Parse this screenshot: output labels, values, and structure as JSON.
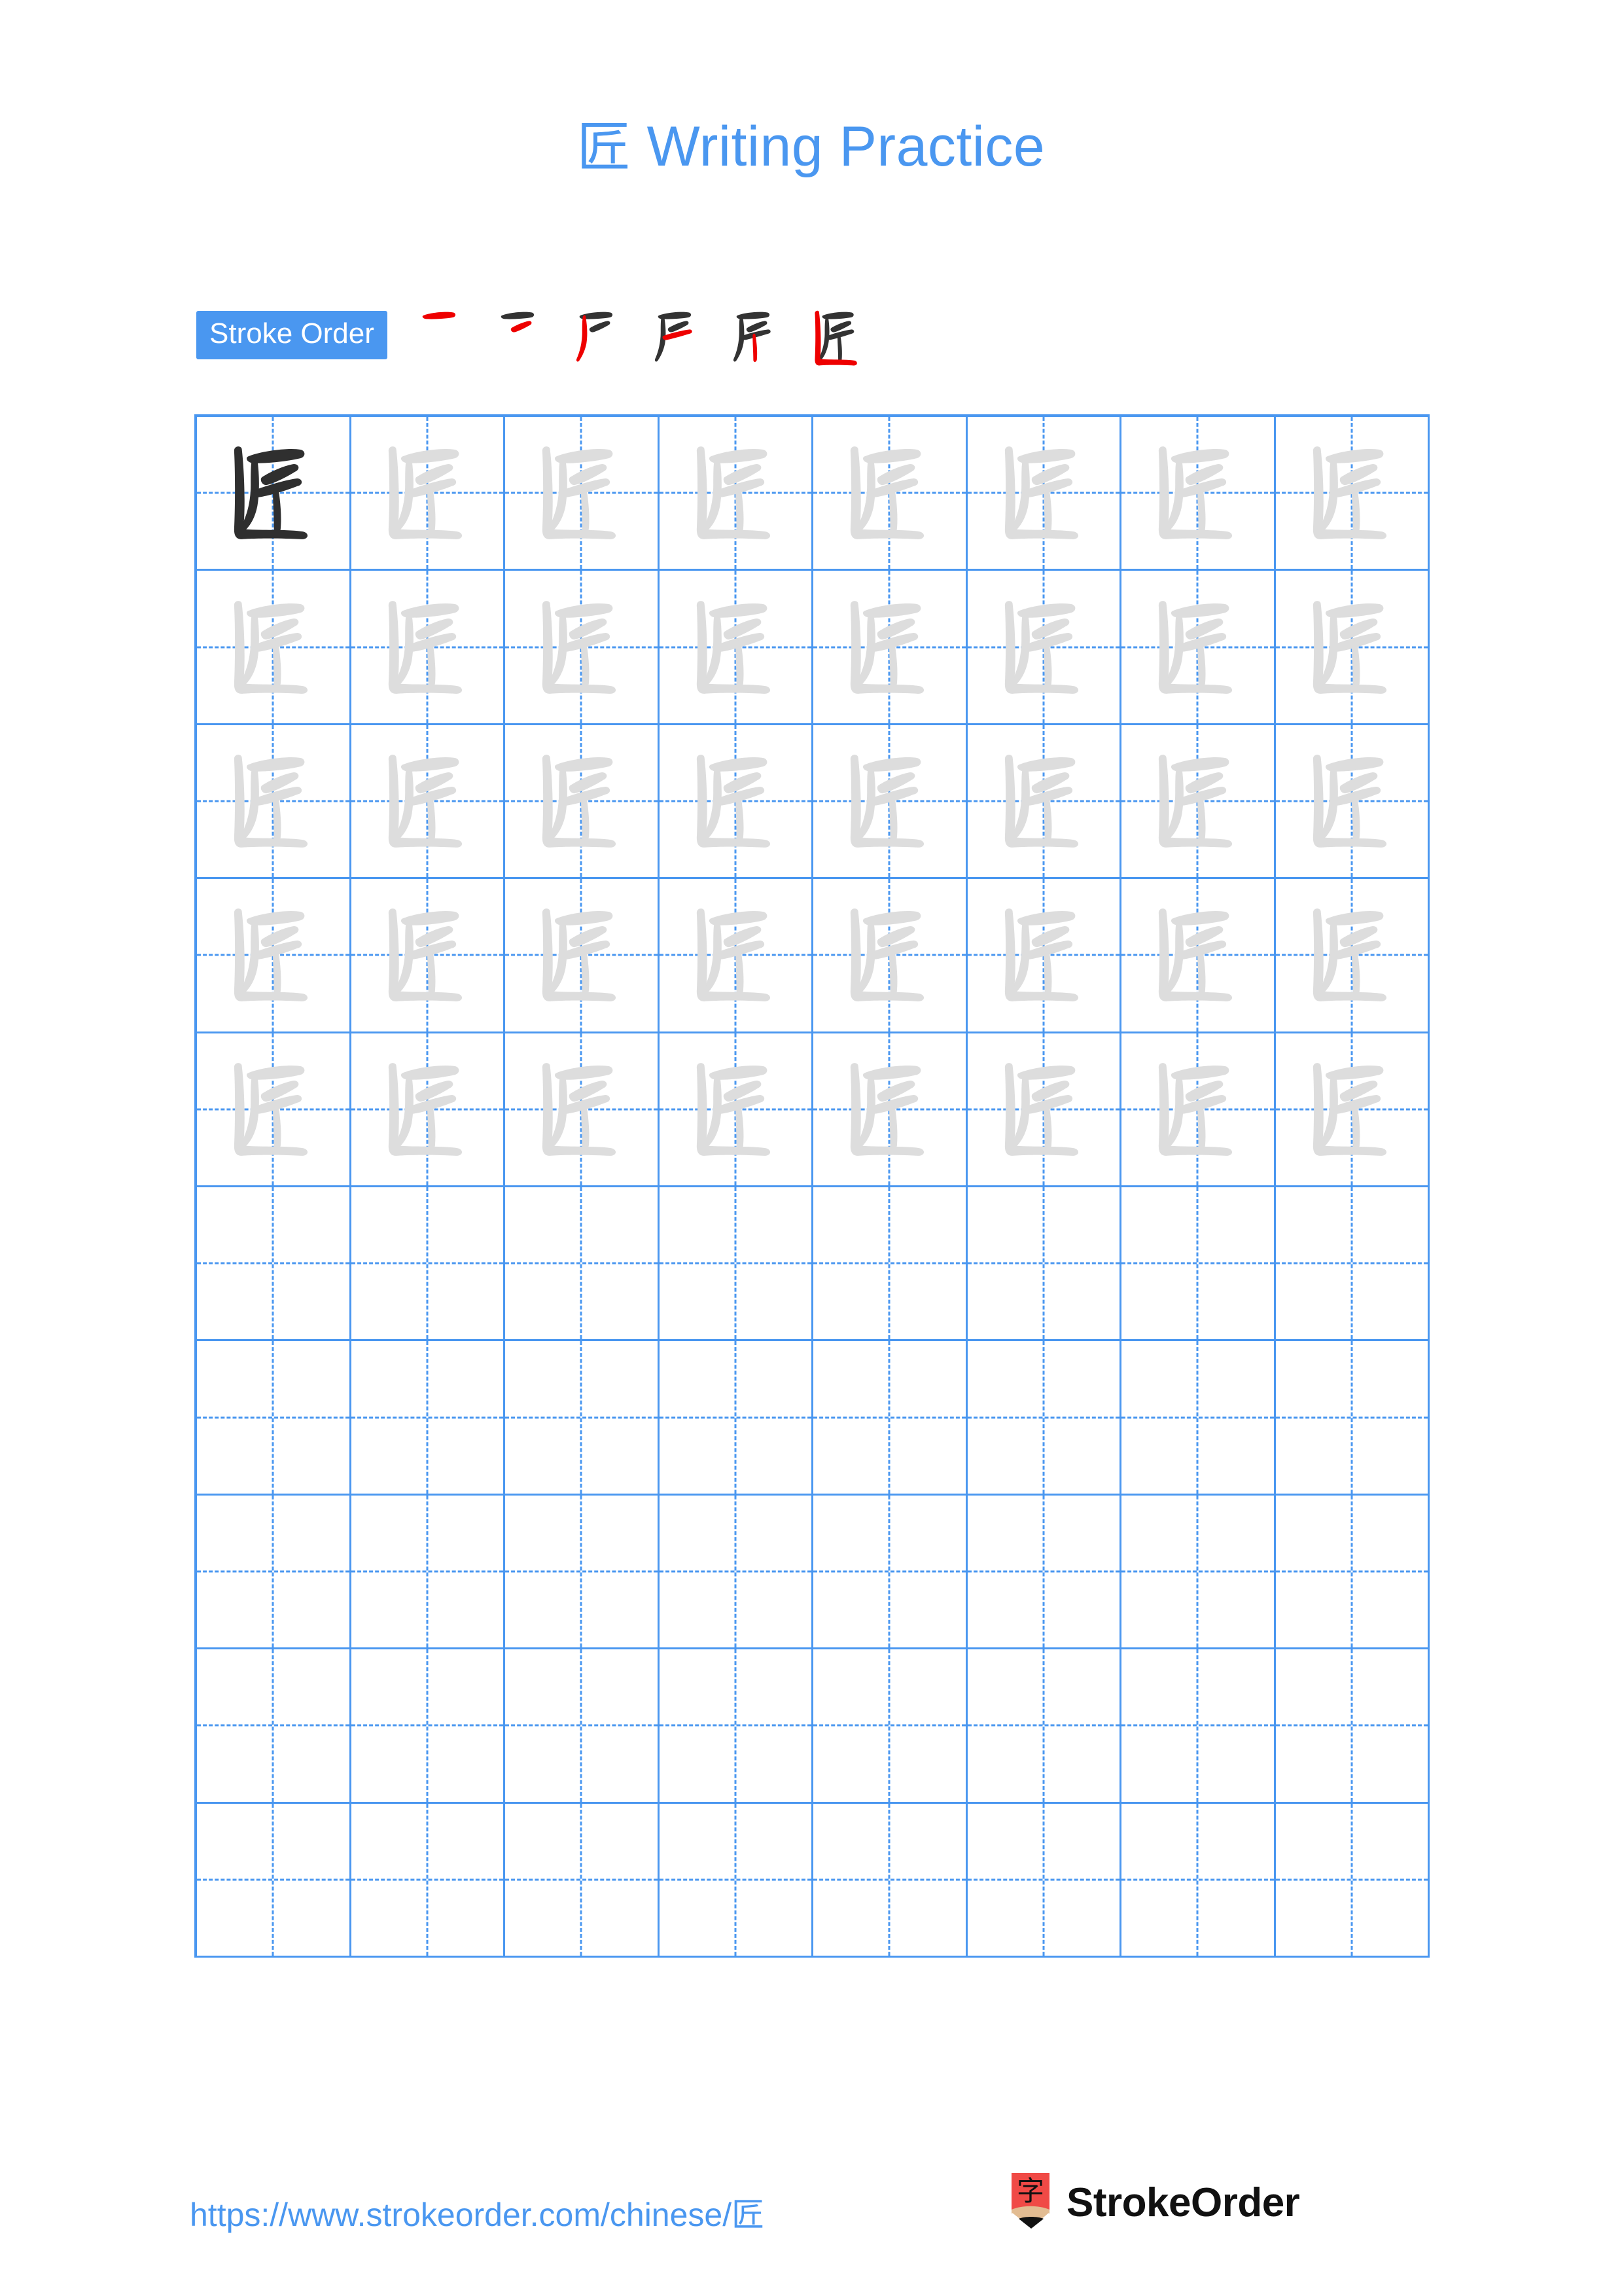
{
  "character": "匠",
  "title": {
    "char": "匠",
    "text": " Writing Practice",
    "full": "匠 Writing Practice",
    "color": "#4a97f0"
  },
  "stroke_order": {
    "badge_label": "Stroke Order",
    "badge_bg": "#4a97f0",
    "badge_text_color": "#ffffff",
    "stroke_count": 6,
    "new_stroke_color": "#ee0000",
    "done_stroke_color": "#333333",
    "steps": [
      {
        "index": 1,
        "new_stroke": "horizontal top stroke",
        "cumulative": "一"
      },
      {
        "index": 2,
        "new_stroke": "short diagonal",
        "cumulative": "二-like"
      },
      {
        "index": 3,
        "new_stroke": "left falling vertical",
        "cumulative": "尸-like"
      },
      {
        "index": 4,
        "new_stroke": "middle horizontal",
        "cumulative": "戸-like"
      },
      {
        "index": 5,
        "new_stroke": "vertical",
        "cumulative": "斤"
      },
      {
        "index": 6,
        "new_stroke": "enclosure 匚",
        "cumulative": "匠"
      }
    ]
  },
  "grid": {
    "columns": 8,
    "rows": 10,
    "filled_rows": 5,
    "empty_rows": 5,
    "line_color": "#4a97f0",
    "dark_glyph_color": "#2f2f2f",
    "light_glyph_color": "#dddddd",
    "cells": [
      [
        "dark",
        "light",
        "light",
        "light",
        "light",
        "light",
        "light",
        "light"
      ],
      [
        "light",
        "light",
        "light",
        "light",
        "light",
        "light",
        "light",
        "light"
      ],
      [
        "light",
        "light",
        "light",
        "light",
        "light",
        "light",
        "light",
        "light"
      ],
      [
        "light",
        "light",
        "light",
        "light",
        "light",
        "light",
        "light",
        "light"
      ],
      [
        "light",
        "light",
        "light",
        "light",
        "light",
        "light",
        "light",
        "light"
      ],
      [
        "empty",
        "empty",
        "empty",
        "empty",
        "empty",
        "empty",
        "empty",
        "empty"
      ],
      [
        "empty",
        "empty",
        "empty",
        "empty",
        "empty",
        "empty",
        "empty",
        "empty"
      ],
      [
        "empty",
        "empty",
        "empty",
        "empty",
        "empty",
        "empty",
        "empty",
        "empty"
      ],
      [
        "empty",
        "empty",
        "empty",
        "empty",
        "empty",
        "empty",
        "empty",
        "empty"
      ],
      [
        "empty",
        "empty",
        "empty",
        "empty",
        "empty",
        "empty",
        "empty",
        "empty"
      ]
    ]
  },
  "footer": {
    "url": "https://www.strokeorder.com/chinese/匠",
    "url_color": "#4a97f0",
    "brand_name": "StrokeOrder",
    "brand_icon_char": "字",
    "brand_icon_color": "#f04a46",
    "brand_icon_wood_color": "#e2bc92",
    "brand_icon_tip_color": "#111111"
  }
}
